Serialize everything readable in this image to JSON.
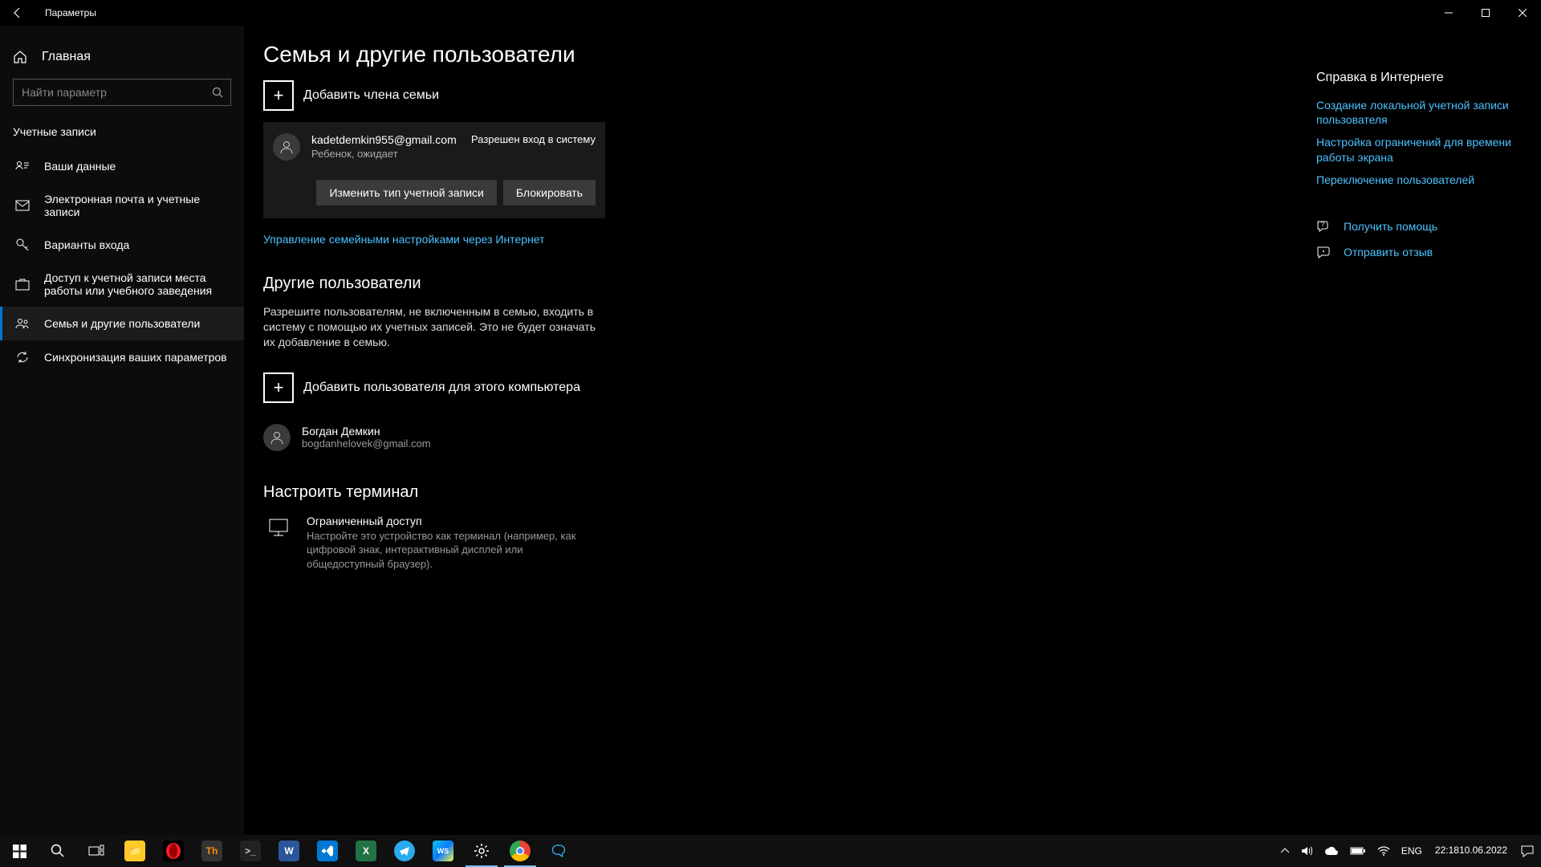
{
  "titlebar": {
    "title": "Параметры"
  },
  "sidebar": {
    "home": "Главная",
    "search_placeholder": "Найти параметр",
    "section": "Учетные записи",
    "items": [
      {
        "label": "Ваши данные"
      },
      {
        "label": "Электронная почта и учетные записи"
      },
      {
        "label": "Варианты входа"
      },
      {
        "label": "Доступ к учетной записи места работы или учебного заведения"
      },
      {
        "label": "Семья и другие пользователи"
      },
      {
        "label": "Синхронизация ваших параметров"
      }
    ]
  },
  "main": {
    "title": "Семья и другие пользователи",
    "add_family": "Добавить члена семьи",
    "family_member": {
      "email": "kadetdemkin955@gmail.com",
      "role": "Ребенок, ожидает",
      "status": "Разрешен вход в систему",
      "change_type": "Изменить тип учетной записи",
      "block": "Блокировать"
    },
    "manage_online": "Управление семейными настройками через Интернет",
    "other_heading": "Другие пользователи",
    "other_desc": "Разрешите пользователям, не включенным в семью, входить в систему с помощью их учетных записей. Это не будет означать их добавление в семью.",
    "add_user": "Добавить пользователя для этого компьютера",
    "other_user": {
      "name": "Богдан Демкин",
      "email": "bogdanhelovek@gmail.com"
    },
    "kiosk_heading": "Настроить терминал",
    "kiosk": {
      "title": "Ограниченный доступ",
      "desc": "Настройте это устройство как терминал (например, как цифровой знак, интерактивный дисплей или общедоступный браузер)."
    }
  },
  "right": {
    "heading": "Справка в Интернете",
    "links": [
      "Создание локальной учетной записи пользователя",
      "Настройка ограничений для времени работы экрана",
      "Переключение пользователей"
    ],
    "get_help": "Получить помощь",
    "feedback": "Отправить отзыв"
  },
  "taskbar": {
    "lang": "ENG",
    "time": "22:18",
    "date": "10.06.2022"
  }
}
